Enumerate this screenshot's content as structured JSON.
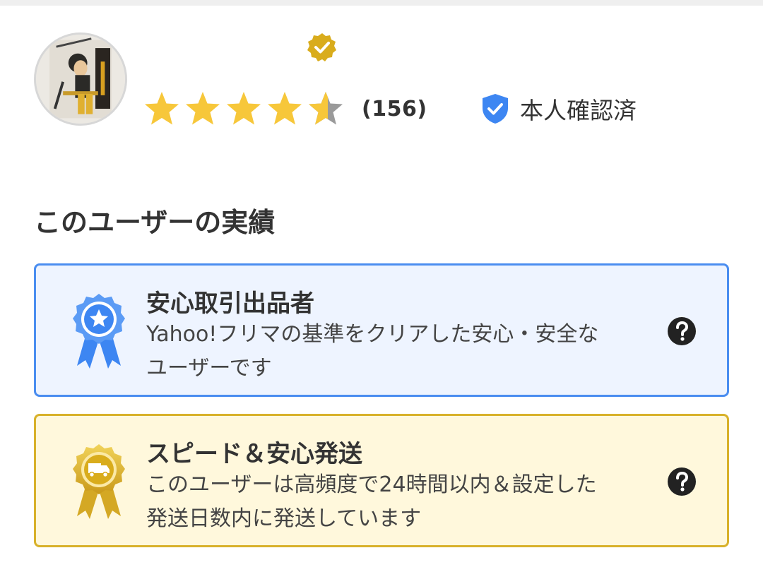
{
  "profile": {
    "avatar_icon": "user-avatar",
    "verified_badge_icon": "gold-check-badge",
    "rating": {
      "stars_filled": 4.5,
      "stars_total": 5,
      "review_count": "(156)",
      "star_color": "#f7c73a"
    },
    "identity": {
      "icon": "shield-check-icon",
      "label": "本人確認済",
      "color": "#3d86f2"
    }
  },
  "achievements": {
    "title": "このユーザーの実績",
    "cards": [
      {
        "icon": "blue-star-ribbon-badge",
        "title": "安心取引出品者",
        "desc_line1": "Yahoo!フリマの基準をクリアした安心・安全な",
        "desc_line2": "ユーザーです",
        "help_icon": "question-circle-icon",
        "accent": "#4a8df0",
        "background": "#eef4ff"
      },
      {
        "icon": "gold-truck-ribbon-badge",
        "title": "スピード＆安心発送",
        "desc_line1": "このユーザーは高頻度で24時間以内＆設定した",
        "desc_line2": "発送日数内に発送しています",
        "help_icon": "question-circle-icon",
        "accent": "#d8b12a",
        "background": "#fff8dc"
      }
    ]
  }
}
